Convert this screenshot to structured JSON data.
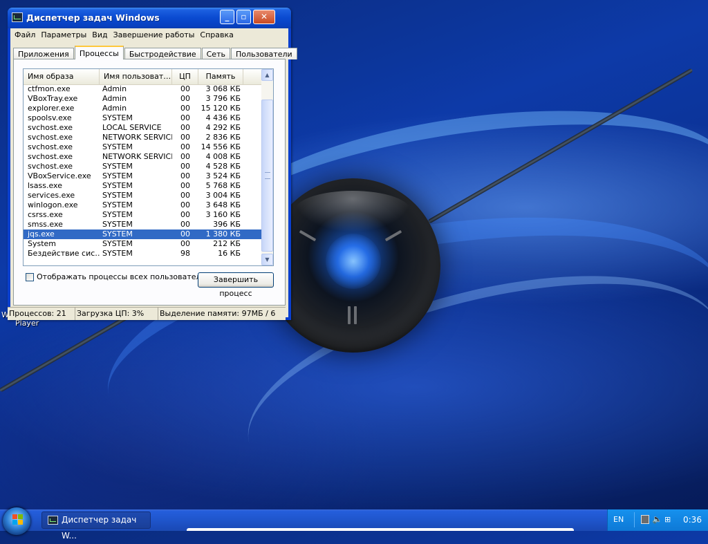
{
  "window": {
    "title": "Диспетчер задач Windows",
    "buttons": {
      "minimize": "_",
      "maximize": "▫",
      "close": "✕"
    }
  },
  "menu": [
    "Файл",
    "Параметры",
    "Вид",
    "Завершение работы",
    "Справка"
  ],
  "tabs": [
    {
      "label": "Приложения",
      "active": false
    },
    {
      "label": "Процессы",
      "active": true
    },
    {
      "label": "Быстродействие",
      "active": false
    },
    {
      "label": "Сеть",
      "active": false
    },
    {
      "label": "Пользователи",
      "active": false
    }
  ],
  "table": {
    "columns": [
      "Имя образа",
      "Имя пользоват…",
      "ЦП",
      "Память"
    ],
    "selected_index": 15,
    "rows": [
      [
        "ctfmon.exe",
        "Admin",
        "00",
        "3 068 КБ"
      ],
      [
        "VBoxTray.exe",
        "Admin",
        "00",
        "3 796 КБ"
      ],
      [
        "explorer.exe",
        "Admin",
        "00",
        "15 120 КБ"
      ],
      [
        "spoolsv.exe",
        "SYSTEM",
        "00",
        "4 436 КБ"
      ],
      [
        "svchost.exe",
        "LOCAL SERVICE",
        "00",
        "4 292 КБ"
      ],
      [
        "svchost.exe",
        "NETWORK SERVICE",
        "00",
        "2 836 КБ"
      ],
      [
        "svchost.exe",
        "SYSTEM",
        "00",
        "14 556 КБ"
      ],
      [
        "svchost.exe",
        "NETWORK SERVICE",
        "00",
        "4 008 КБ"
      ],
      [
        "svchost.exe",
        "SYSTEM",
        "00",
        "4 528 КБ"
      ],
      [
        "VBoxService.exe",
        "SYSTEM",
        "00",
        "3 524 КБ"
      ],
      [
        "lsass.exe",
        "SYSTEM",
        "00",
        "5 768 КБ"
      ],
      [
        "services.exe",
        "SYSTEM",
        "00",
        "3 004 КБ"
      ],
      [
        "winlogon.exe",
        "SYSTEM",
        "00",
        "3 648 КБ"
      ],
      [
        "csrss.exe",
        "SYSTEM",
        "00",
        "3 160 КБ"
      ],
      [
        "smss.exe",
        "SYSTEM",
        "00",
        "396 КБ"
      ],
      [
        "jqs.exe",
        "SYSTEM",
        "00",
        "1 380 КБ"
      ],
      [
        "System",
        "SYSTEM",
        "00",
        "212 КБ"
      ],
      [
        "Бездействие сис…",
        "SYSTEM",
        "98",
        "16 КБ"
      ]
    ]
  },
  "checkbox": {
    "label": "Отображать процессы всех пользователей",
    "checked": false
  },
  "end_button": "Завершить процесс",
  "status": {
    "processes": "Процессов: 21",
    "cpu": "Загрузка ЦП: 3%",
    "memory": "Выделение памяти: 97МБ / 6"
  },
  "desktop": {
    "icon_label_top": "W",
    "icon_label": "Player"
  },
  "taskbar": {
    "task_label": "Диспетчер задач W...",
    "lang": "EN",
    "time": "0:36"
  },
  "colors": {
    "selection": "#316ac5",
    "title_blue": "#0a4ad0",
    "tray": "#1691ee"
  }
}
